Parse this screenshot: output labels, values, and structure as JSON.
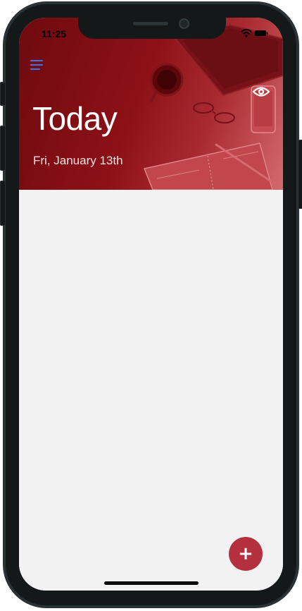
{
  "status_bar": {
    "time": "11:25",
    "icons": [
      "wifi-icon",
      "battery-icon"
    ]
  },
  "header": {
    "menu_icon": "hamburger-menu-icon",
    "title": "Today",
    "date": "Fri, January 13th",
    "visibility_icon": "eye-icon",
    "background": "desk-with-coffee-cup-phone-and-notebook"
  },
  "fab": {
    "icon": "plus-icon",
    "label": "+"
  },
  "colors": {
    "header_dark": "#6e0a0e",
    "header_light": "#d46a6c",
    "accent": "#b5303e",
    "menu_icon": "#3a73e8",
    "background": "#f2f2f2"
  }
}
